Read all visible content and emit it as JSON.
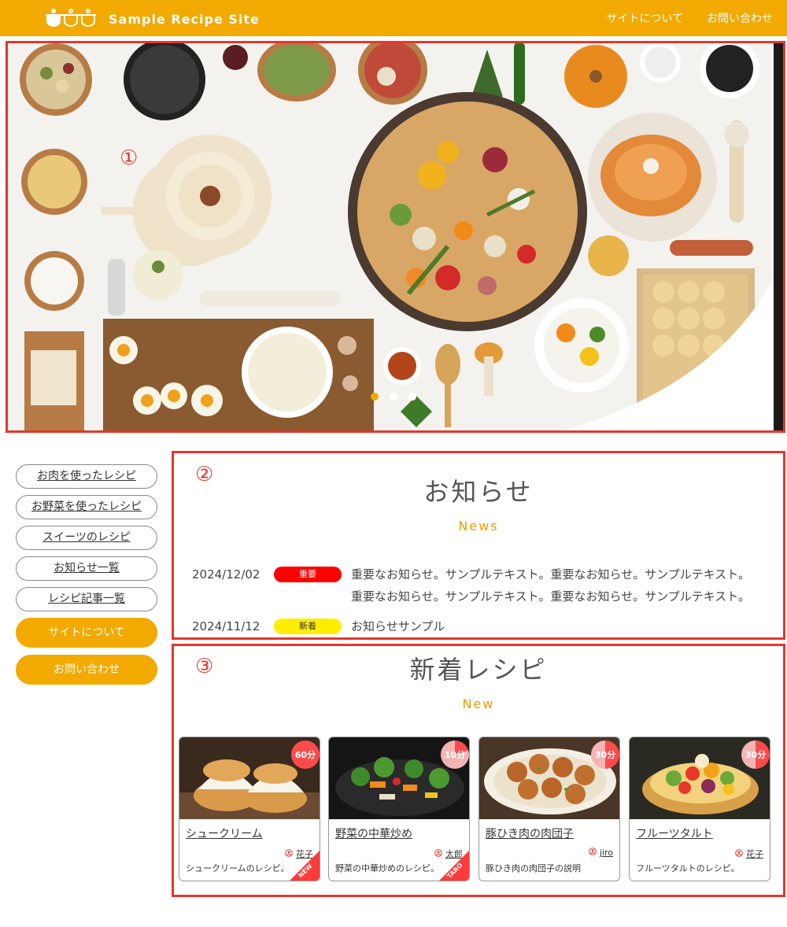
{
  "header": {
    "logo_text": "Sample Recipe Site",
    "nav": [
      "サイトについて",
      "お問い合わせ"
    ],
    "color": "#f2a900"
  },
  "hero": {
    "marker": "①",
    "slide_count": 3,
    "active_slide": 1
  },
  "sidebar": {
    "outline_items": [
      "お肉を使ったレシピ",
      "お野菜を使ったレシピ",
      "スイーツのレシピ",
      "お知らせ一覧",
      "レシピ記事一覧"
    ],
    "solid_items": [
      "サイトについて",
      "お問い合わせ"
    ]
  },
  "news": {
    "marker": "②",
    "title": "お知らせ",
    "subtitle": "News",
    "items": [
      {
        "date": "2024/12/02",
        "tag": "重要",
        "tag_color": "#ff0000",
        "text": "重要なお知らせ。サンプルテキスト。重要なお知らせ。サンプルテキスト。重要なお知らせ。サンプルテキスト。重要なお知らせ。サンプルテキスト。"
      },
      {
        "date": "2024/11/12",
        "tag": "新着",
        "tag_color": "#ffee00",
        "text": "お知らせサンプル"
      }
    ]
  },
  "recipes": {
    "marker": "③",
    "title": "新着レシピ",
    "subtitle": "New",
    "cards": [
      {
        "title": "シュークリーム",
        "time": "60分",
        "author": "花子",
        "desc": "シュークリームのレシピ。",
        "ribbon": "NEW"
      },
      {
        "title": "野菜の中華炒め",
        "time": "10分",
        "author": "太郎",
        "desc": "野菜の中華炒めのレシピ。",
        "ribbon": "TARO"
      },
      {
        "title": "豚ひき肉の肉団子",
        "time": "30分",
        "author": "jiro",
        "desc": "豚ひき肉の肉団子の説明",
        "ribbon": ""
      },
      {
        "title": "フルーツタルト",
        "time": "30分",
        "author": "花子",
        "desc": "フルーツタルトのレシピ。",
        "ribbon": ""
      }
    ]
  }
}
